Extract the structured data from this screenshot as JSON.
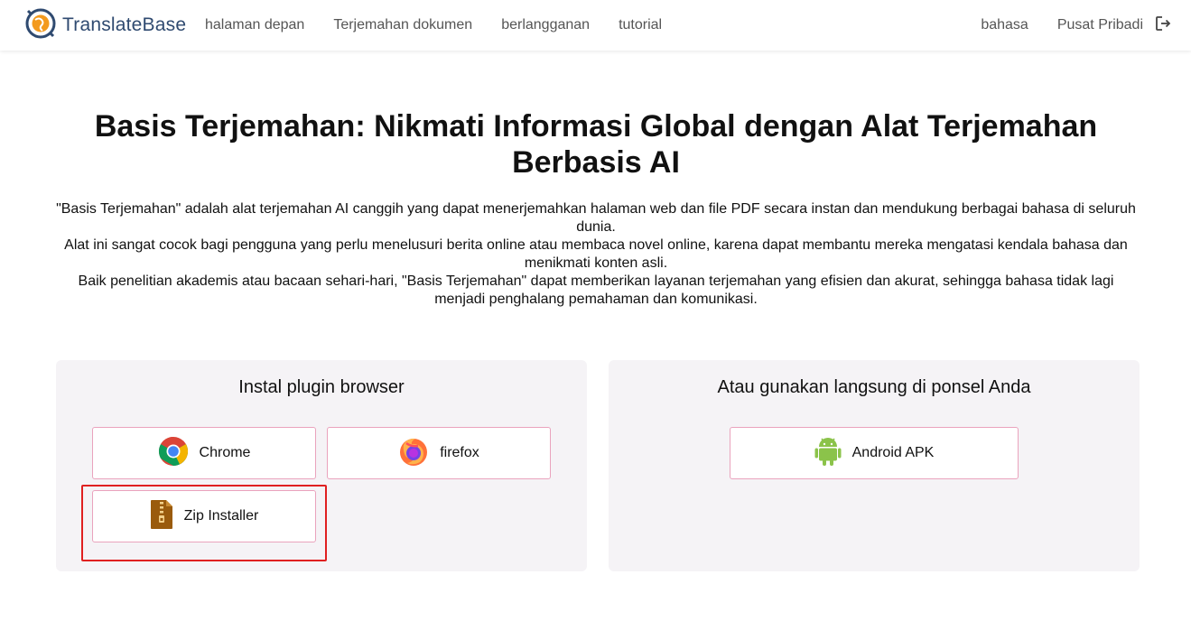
{
  "header": {
    "logo_text": "TranslateBase",
    "nav": [
      {
        "label": "halaman depan"
      },
      {
        "label": "Terjemahan dokumen"
      },
      {
        "label": "berlangganan"
      },
      {
        "label": "tutorial"
      }
    ],
    "language_label": "bahasa",
    "profile_label": "Pusat Pribadi",
    "logout_icon": "logout-icon"
  },
  "hero": {
    "title_line1": "Basis Terjemahan: Nikmati Informasi Global dengan Alat Terjemahan",
    "title_line2": "Berbasis AI",
    "paragraphs": [
      "\"Basis Terjemahan\" adalah alat terjemahan AI canggih yang dapat menerjemahkan halaman web dan file PDF secara instan dan mendukung berbagai bahasa di seluruh dunia.",
      "Alat ini sangat cocok bagi pengguna yang perlu menelusuri berita online atau membaca novel online, karena dapat membantu mereka mengatasi kendala bahasa dan menikmati konten asli.",
      "Baik penelitian akademis atau bacaan sehari-hari, \"Basis Terjemahan\" dapat memberikan layanan terjemahan yang efisien dan akurat, sehingga bahasa tidak lagi menjadi penghalang pemahaman dan komunikasi."
    ]
  },
  "plugin_card": {
    "title": "Instal plugin browser",
    "buttons": {
      "chrome": "Chrome",
      "firefox": "firefox",
      "zip": "Zip Installer"
    }
  },
  "mobile_card": {
    "title": "Atau gunakan langsung di ponsel Anda",
    "buttons": {
      "android": "Android APK"
    }
  },
  "colors": {
    "accent_border": "#eaa3bd",
    "card_bg": "#f5f3f6",
    "highlight": "#e02020",
    "logo_text": "#2f4a70"
  }
}
